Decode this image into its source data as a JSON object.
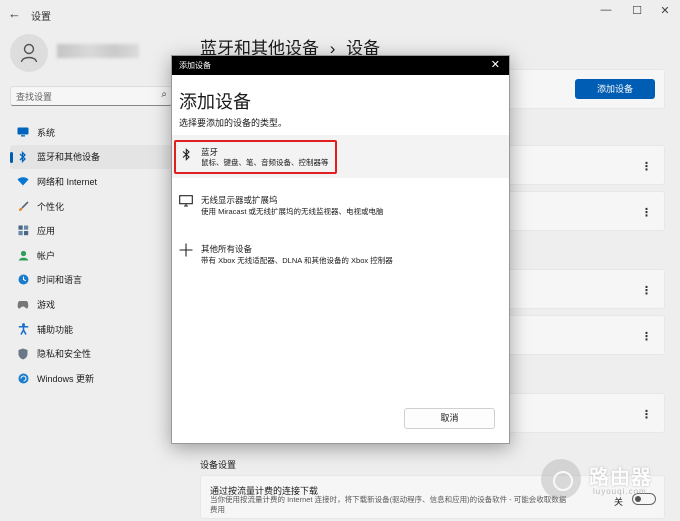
{
  "app": {
    "title": "设置",
    "back": "←"
  },
  "window_controls": {
    "minimize": "—",
    "maximize": "☐",
    "close": "✕"
  },
  "search": {
    "placeholder": "查找设置"
  },
  "sidebar": {
    "items": [
      {
        "label": "系统",
        "icon": "monitor-icon",
        "color": "#0067c0"
      },
      {
        "label": "蓝牙和其他设备",
        "icon": "bluetooth-icon",
        "color": "#0067c0",
        "active": true
      },
      {
        "label": "网络和 Internet",
        "icon": "wifi-icon",
        "color": "#0a79d6"
      },
      {
        "label": "个性化",
        "icon": "brush-icon",
        "color": "#e68a2e"
      },
      {
        "label": "应用",
        "icon": "apps-icon",
        "color": "#4a6a8a"
      },
      {
        "label": "帐户",
        "icon": "account-icon",
        "color": "#2fa15a"
      },
      {
        "label": "时间和语言",
        "icon": "globe-clock-icon",
        "color": "#1a7fd1"
      },
      {
        "label": "游戏",
        "icon": "gamepad-icon",
        "color": "#7a7a7a"
      },
      {
        "label": "辅助功能",
        "icon": "accessibility-icon",
        "color": "#1a6ed1"
      },
      {
        "label": "隐私和安全性",
        "icon": "shield-icon",
        "color": "#6b7b8b"
      },
      {
        "label": "Windows 更新",
        "icon": "update-icon",
        "color": "#1a7fd1"
      }
    ]
  },
  "main": {
    "breadcrumb_parent": "蓝牙和其他设备",
    "breadcrumb_sep": "›",
    "breadcrumb_current": "设备",
    "add_device_label": "添加设备",
    "section_title": "设备设置",
    "metered": {
      "title": "通过按流量计费的连接下载",
      "desc": "当你使用按流量计费的 Internet 连接时，将下载新设备(驱动程序、信息和应用)的设备软件 - 可能会收取数据费用",
      "toggle_label": "关",
      "toggle_on": false
    }
  },
  "dialog": {
    "title": "添加设备",
    "heading": "添加设备",
    "subtitle": "选择要添加的设备的类型。",
    "options": [
      {
        "title": "蓝牙",
        "desc": "鼠标、键盘、笔、音频设备、控制器等",
        "icon": "bluetooth-icon"
      },
      {
        "title": "无线显示器或扩展坞",
        "desc": "使用 Miracast 或无线扩展坞的无线监视器、电视或电脑",
        "icon": "display-icon"
      },
      {
        "title": "其他所有设备",
        "desc": "带有 Xbox 无线适配器、DLNA 和其他设备的 Xbox 控制器",
        "icon": "plus-icon"
      }
    ],
    "cancel_label": "取消",
    "highlight_color": "#e02020"
  },
  "watermark": {
    "text": "路由器",
    "sub": "luyouqi.com"
  }
}
